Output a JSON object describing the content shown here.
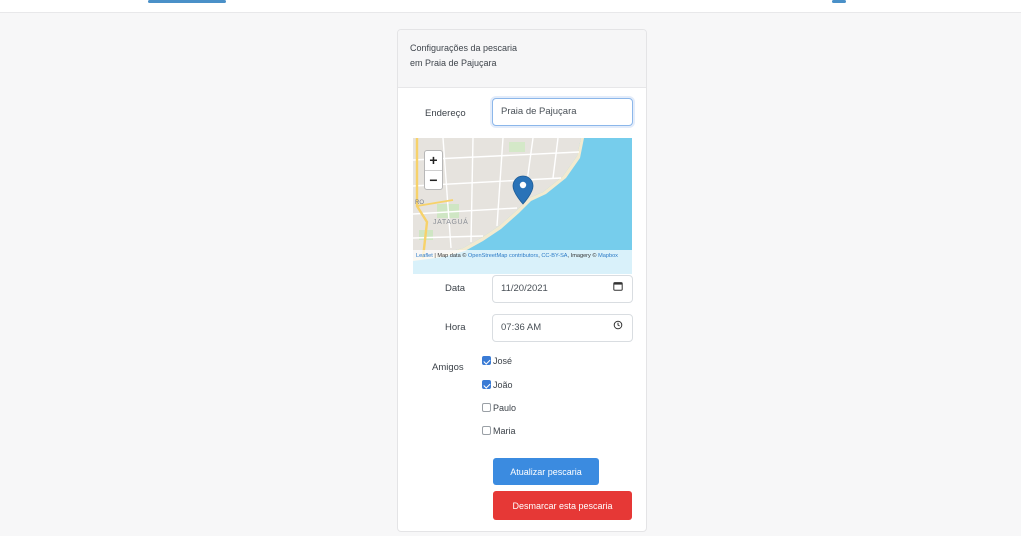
{
  "card": {
    "title_line1": "Configurações da pescaria",
    "title_line2": "em Praia de Pajuçara"
  },
  "form": {
    "endereco_label": "Endereço",
    "endereco_value": "Praia de Pajuçara",
    "data_label": "Data",
    "data_value": "11/20/2021",
    "hora_label": "Hora",
    "hora_value": "07:36 AM",
    "amigos_label": "Amigos",
    "amigos": [
      {
        "name": "José",
        "checked": true
      },
      {
        "name": "João",
        "checked": true
      },
      {
        "name": "Paulo",
        "checked": false
      },
      {
        "name": "Maria",
        "checked": false
      }
    ],
    "update_button": "Atualizar pescaria",
    "cancel_button": "Desmarcar esta pescaria"
  },
  "map": {
    "zoom_in": "+",
    "zoom_out": "−",
    "district_label": "JATAGUÁ",
    "side_label": "RO",
    "attribution_leaflet": "Leaflet",
    "attribution_sep": " | Map data © ",
    "attribution_osm": "OpenStreetMap contributors",
    "attribution_sep2": ", ",
    "attribution_cc": "CC-BY-SA",
    "attribution_imagery": ", Imagery © ",
    "attribution_mapbox": "Mapbox"
  },
  "colors": {
    "primary": "#3b8be0",
    "danger": "#e63836",
    "water": "#76cdec",
    "marker": "#2a73b8"
  },
  "icons": {
    "date": "calendar-icon",
    "time": "clock-icon",
    "marker": "map-marker-icon"
  }
}
